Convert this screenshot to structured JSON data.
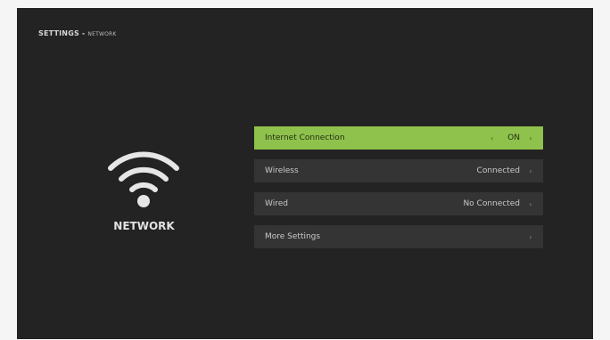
{
  "breadcrumb": {
    "main": "SETTINGS - ",
    "sub": "NETWORK"
  },
  "page": {
    "title": "NETWORK",
    "icon": "wifi-icon"
  },
  "menu": {
    "items": [
      {
        "label": "Internet Connection",
        "value": "ON",
        "active": true
      },
      {
        "label": "Wireless",
        "value": "Connected"
      },
      {
        "label": "Wired",
        "value": "No Connected"
      },
      {
        "label": "More Settings",
        "value": ""
      }
    ]
  },
  "colors": {
    "background": "#232323",
    "accent": "#8fc24c",
    "row": "#343434"
  }
}
